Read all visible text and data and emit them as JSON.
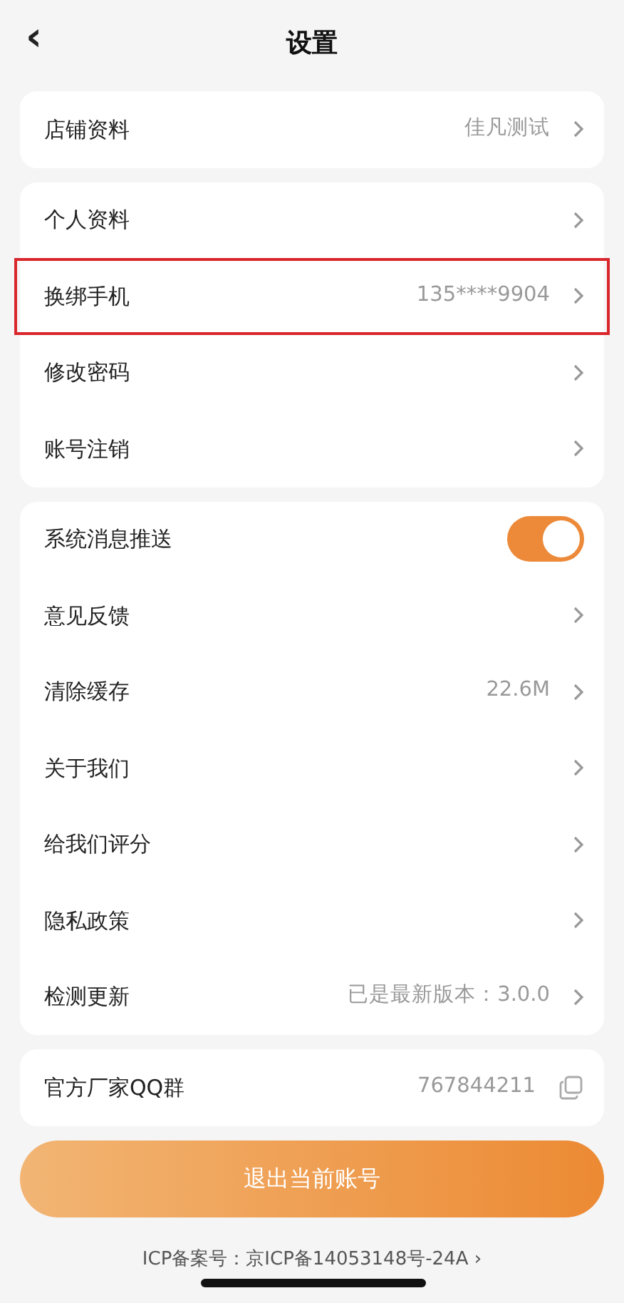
{
  "header": {
    "back": "‹",
    "title": "设置"
  },
  "groups": [
    {
      "items": [
        {
          "kind": "link",
          "label": "店铺资料",
          "value": "佳凡测试",
          "highlighted": false
        }
      ]
    },
    {
      "items": [
        {
          "kind": "link",
          "label": "个人资料",
          "highlighted": false
        },
        {
          "kind": "link",
          "label": "换绑手机",
          "value": "135****9904",
          "highlighted": true
        },
        {
          "kind": "link",
          "label": "修改密码",
          "highlighted": false
        },
        {
          "kind": "link",
          "label": "账号注销",
          "highlighted": false
        }
      ]
    },
    {
      "items": [
        {
          "kind": "toggle",
          "label": "系统消息推送",
          "on": true
        },
        {
          "kind": "link",
          "label": "意见反馈",
          "highlighted": false
        },
        {
          "kind": "link",
          "label": "清除缓存",
          "value": "22.6M",
          "highlighted": false
        },
        {
          "kind": "link",
          "label": "关于我们",
          "highlighted": false
        },
        {
          "kind": "link",
          "label": "给我们评分",
          "highlighted": false
        },
        {
          "kind": "link",
          "label": "隐私政策",
          "highlighted": false
        },
        {
          "kind": "link",
          "label": "检测更新",
          "value": "已是最新版本：3.0.0",
          "highlighted": false
        }
      ]
    },
    {
      "items": [
        {
          "kind": "copy",
          "label": "官方厂家QQ群",
          "value": "767844211"
        }
      ]
    }
  ],
  "logout_button": "退出当前账号",
  "icp": {
    "text": "ICP备案号：京ICP备14053148号-24A",
    "arrow": "›"
  }
}
